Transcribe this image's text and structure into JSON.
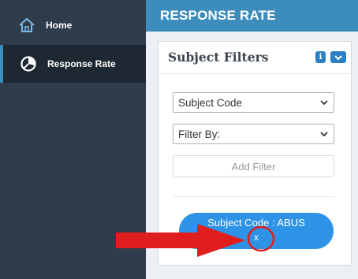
{
  "sidebar": {
    "items": [
      {
        "label": "Home",
        "icon": "home-icon"
      },
      {
        "label": "Response Rate",
        "icon": "pie-chart-icon",
        "active": true
      }
    ]
  },
  "header": {
    "title": "RESPONSE RATE"
  },
  "panel": {
    "title": "Subject Filters",
    "info_badge": "i",
    "subject_code_select": {
      "value": "Subject Code"
    },
    "filter_by_select": {
      "value": "Filter By:"
    },
    "add_filter_label": "Add Filter",
    "chip": {
      "label": "Subject Code : ABUS",
      "remove_label": "x"
    }
  },
  "colors": {
    "sidebar": "#2f3c4c",
    "header": "#3c8dbc",
    "chip": "#2e93e6",
    "annotation": "#e01e1e"
  }
}
